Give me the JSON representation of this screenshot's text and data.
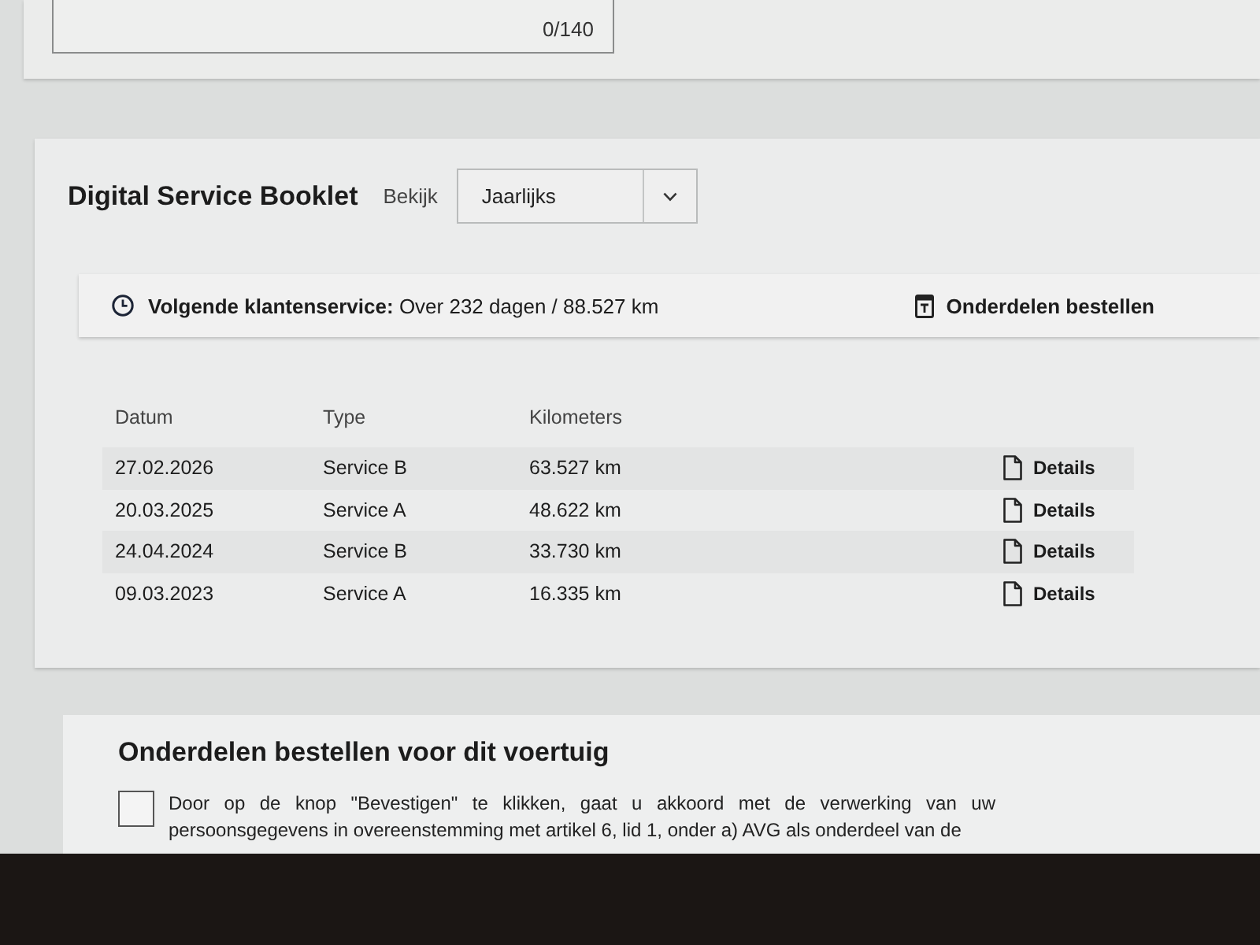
{
  "top_card": {
    "counter": "0/140"
  },
  "booklet": {
    "title": "Digital Service Booklet",
    "view_label": "Bekijk",
    "view_select": {
      "value": "Jaarlijks"
    },
    "next_service": {
      "text": "**Volgende klantenservice:** Over 232 dagen / 88.527 km",
      "link": "Onderdelen bestellen"
    },
    "table": {
      "columns": [
        "Datum",
        "Type",
        "Kilometers"
      ],
      "rows": [
        {
          "date": "27.02.2026",
          "type": "Service B",
          "km": "63.527 km",
          "details": "Details"
        },
        {
          "date": "20.03.2025",
          "type": "Service A",
          "km": "48.622 km",
          "details": "Details"
        },
        {
          "date": "24.04.2024",
          "type": "Service B",
          "km": "33.730 km",
          "details": "Details"
        },
        {
          "date": "09.03.2023",
          "type": "Service A",
          "km": "16.335 km",
          "details": "Details"
        }
      ]
    }
  },
  "order_section": {
    "title": "Onderdelen bestellen voor dit voertuig",
    "consent": {
      "checked": false,
      "text": "Door op de knop \"Bevestigen\" te klikken, gaat u akkoord met de verwerking van uw persoonsgegevens in overeenstemming met artikel 6, lid 1, onder a) AVG als onderdeel van de"
    }
  }
}
